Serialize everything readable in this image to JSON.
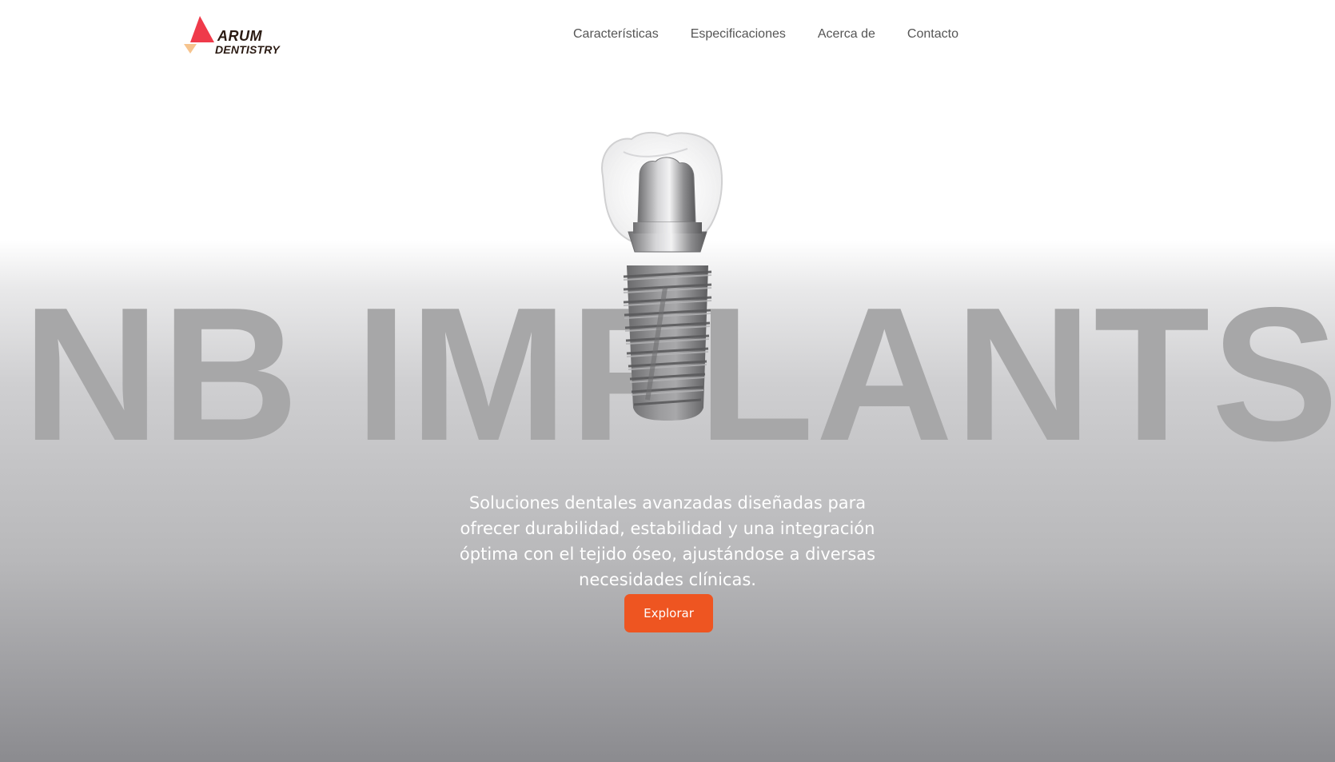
{
  "brand": {
    "name_line1": "ARUM",
    "name_line2": "DENTISTRY",
    "colors": {
      "triangle_red": "#ef3a4a",
      "triangle_peach": "#f6c48e",
      "text": "#2a1a12"
    }
  },
  "nav": {
    "items": [
      {
        "label": "Características"
      },
      {
        "label": "Especificaciones"
      },
      {
        "label": "Acerca de"
      },
      {
        "label": "Contacto"
      }
    ]
  },
  "hero": {
    "title": "NB IMPLANTS",
    "description": "Soluciones dentales avanzadas diseñadas para ofrecer durabilidad, estabilidad y una integración óptima con el tejido óseo, ajustándose a diversas necesidades clínicas.",
    "cta_label": "Explorar",
    "image_icon": "dental-implant-illustration"
  },
  "colors": {
    "accent": "#ee5521",
    "title_gray": "#a7a7a8",
    "nav_text": "#555555"
  }
}
